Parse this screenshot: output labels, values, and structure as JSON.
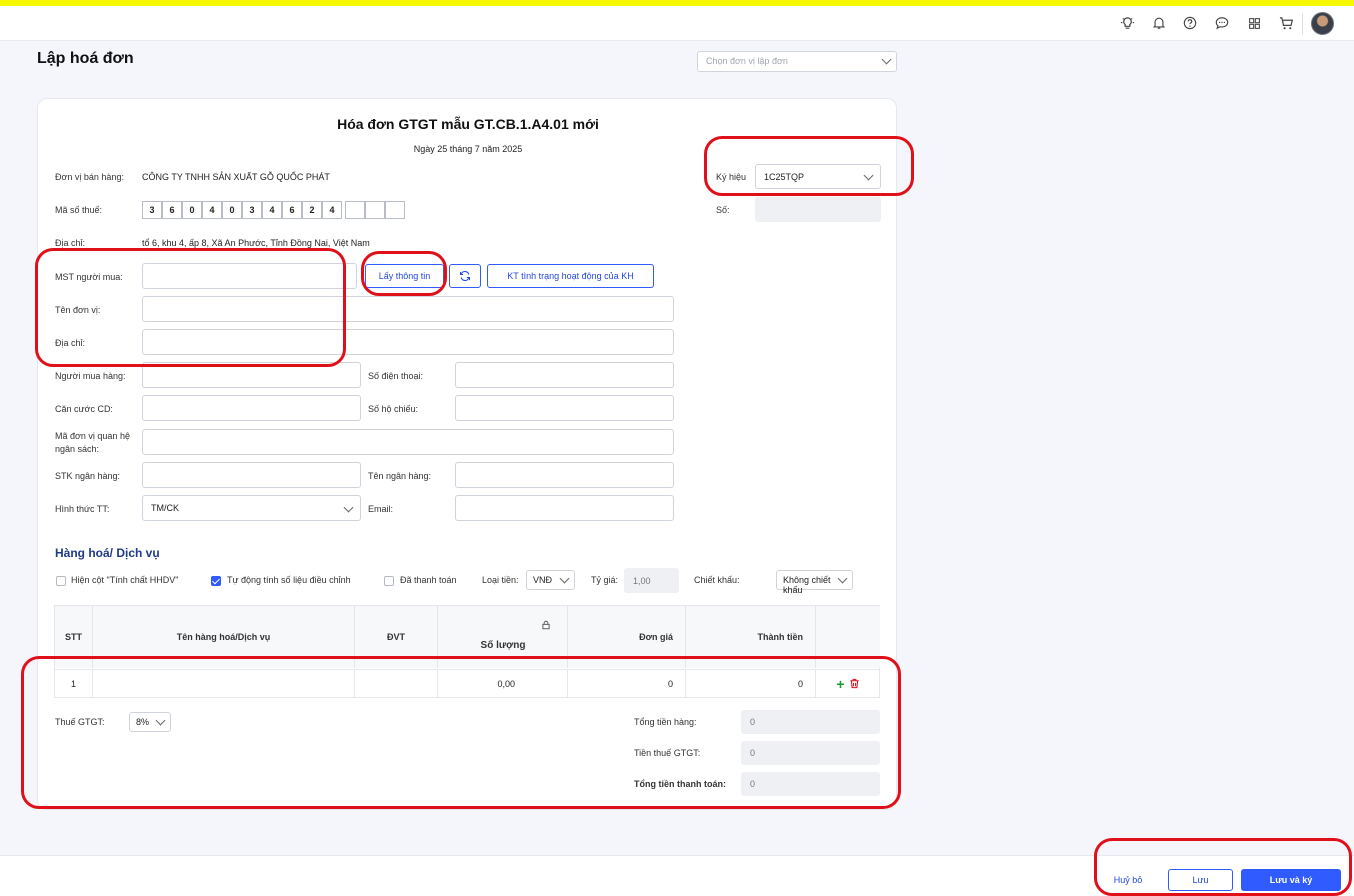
{
  "topbar": {
    "icons": [
      "lightbulb-icon",
      "bell-icon",
      "help-icon",
      "chat-icon",
      "apps-grid-icon",
      "cart-icon"
    ]
  },
  "page": {
    "title": "Lập hoá đơn",
    "unit_select_placeholder": "Chọn đơn vị lập đơn"
  },
  "invoice": {
    "title": "Hóa đơn GTGT mẫu GT.CB.1.A4.01 mới",
    "date": "Ngày 25 tháng 7 năm 2025",
    "symbol_label": "Ký hiệu",
    "symbol_value": "1C25TQP",
    "number_label": "Số:",
    "seller": {
      "name_label": "Đơn vị bán hàng:",
      "name_value": "CÔNG TY TNHH SẢN XUẤT GỖ QUỐC PHÁT",
      "tax_label": "Mã số thuế:",
      "tax_digits": [
        "3",
        "6",
        "0",
        "4",
        "0",
        "3",
        "4",
        "6",
        "2",
        "4",
        "",
        "",
        ""
      ],
      "address_label": "Địa chỉ:",
      "address_value": "tổ 6, khu 4, ấp 8, Xã An Phước, Tỉnh Đồng Nai, Việt Nam"
    },
    "buyer": {
      "mst_label": "MST người mua:",
      "get_info_button": "Lấy thông tin",
      "check_status_button": "KT tình trạng hoạt động của KH",
      "unit_name_label": "Tên đơn vị:",
      "address_label": "Địa chỉ:",
      "buyer_label": "Người mua hàng:",
      "phone_label": "Số điện thoại:",
      "id_label": "Căn cước CD:",
      "passport_label": "Số hộ chiếu:",
      "budget_code_label_1": "Mã đơn vị quan hệ",
      "budget_code_label_2": "ngân sách:",
      "bank_account_label": "STK ngân hàng:",
      "bank_name_label": "Tên ngân hàng:",
      "payment_label": "Hình thức TT:",
      "payment_value": "TM/CK",
      "email_label": "Email:"
    }
  },
  "goods": {
    "section_title": "Hàng hoá/ Dịch vụ",
    "opt_show_col": "Hiện cột \"Tính chất HHDV\"",
    "opt_auto_calc": "Tự động tính số liệu điều chỉnh",
    "opt_paid": "Đã thanh toán",
    "currency_label": "Loại tiền:",
    "currency_value": "VNĐ",
    "rate_label": "Tỷ giá:",
    "rate_value": "1,00",
    "discount_label": "Chiết khấu:",
    "discount_value": "Không chiết khấu",
    "columns": {
      "stt": "STT",
      "name": "Tên hàng hoá/Dịch vụ",
      "unit": "ĐVT",
      "qty": "Số lượng",
      "price": "Đơn giá",
      "amount": "Thành tiền"
    },
    "row": {
      "stt": "1",
      "qty": "0,00",
      "price": "0",
      "amount": "0"
    },
    "vat_label": "Thuế GTGT:",
    "vat_value": "8%",
    "total_goods_label": "Tổng tiền hàng:",
    "total_goods_value": "0",
    "total_vat_label": "Tiền thuế GTGT:",
    "total_vat_value": "0",
    "total_pay_label": "Tổng tiền thanh toán:",
    "total_pay_value": "0"
  },
  "footer": {
    "cancel": "Huỷ bỏ",
    "save": "Lưu",
    "save_sign": "Lưu và ký"
  }
}
